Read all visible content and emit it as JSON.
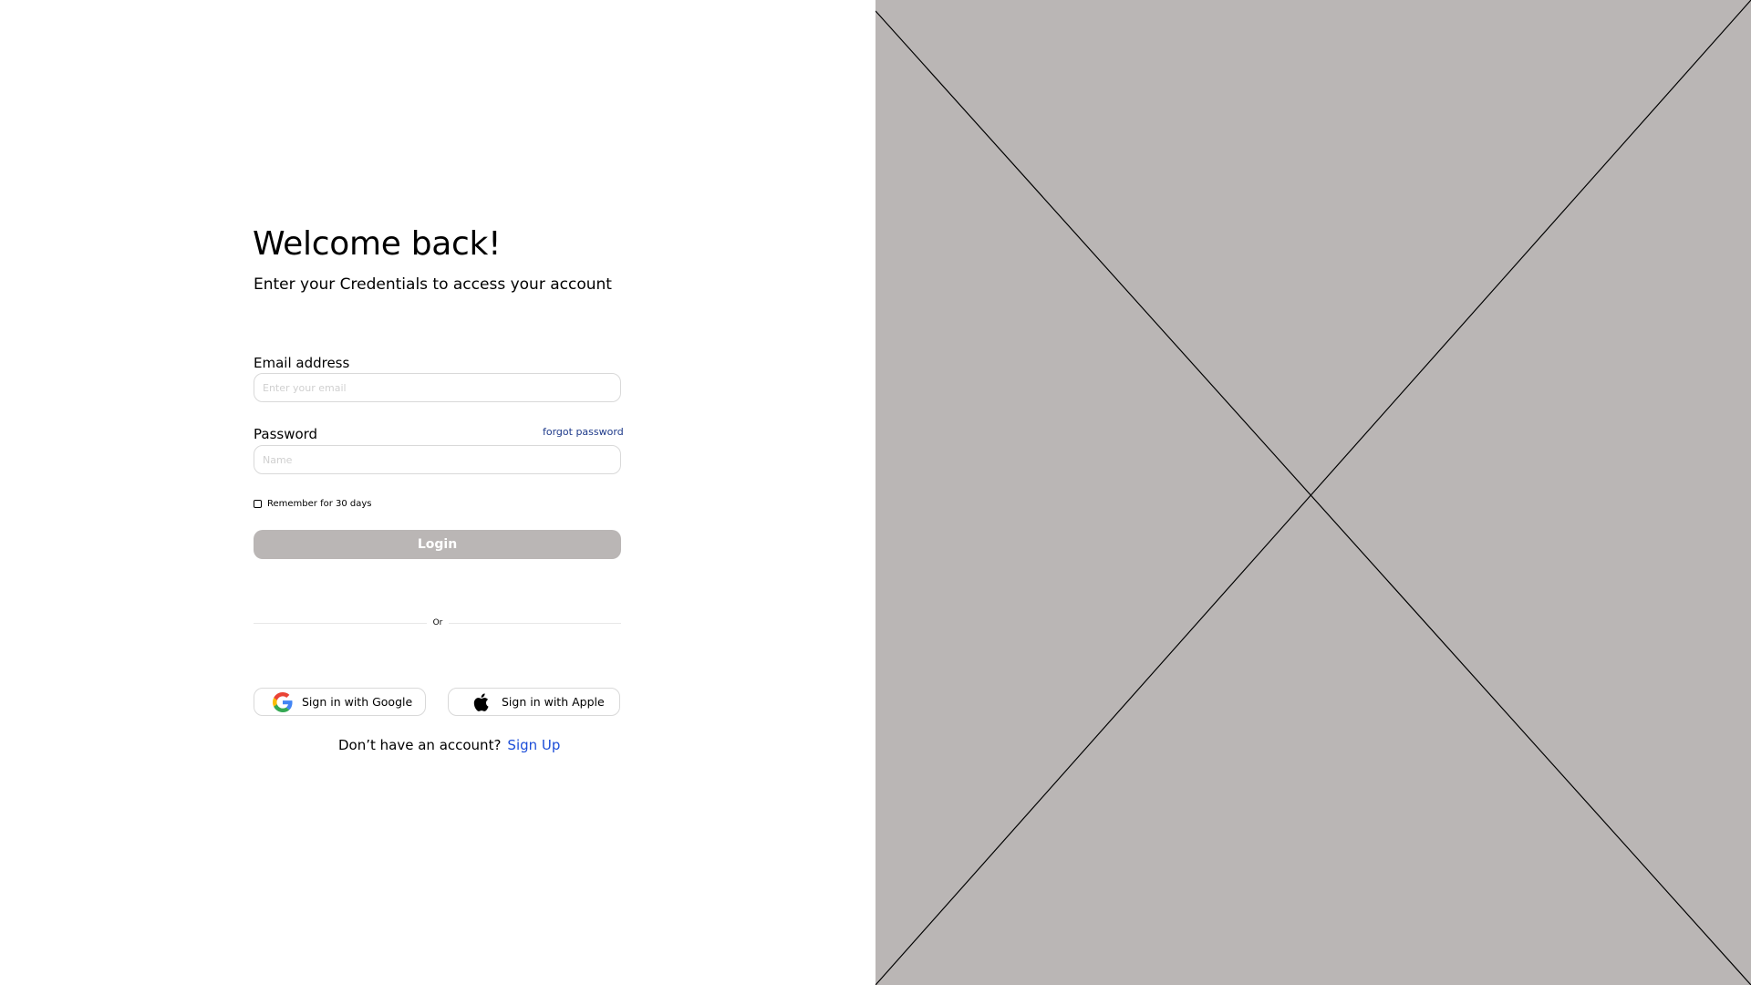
{
  "login": {
    "title": "Welcome back!",
    "subtitle": "Enter your Credentials to access your account",
    "email": {
      "label": "Email address",
      "placeholder": "Enter your email",
      "value": ""
    },
    "password": {
      "label": "Password",
      "placeholder": "Name",
      "value": "",
      "forgot_label": "forgot password"
    },
    "remember": {
      "label": "Remember for 30 days",
      "checked": false
    },
    "login_button": {
      "label": "Login"
    },
    "divider_label": "Or",
    "social": {
      "google_label": "Sign in with Google",
      "google_icon": "google-icon",
      "apple_label": "Sign in with Apple",
      "apple_icon": "apple-icon"
    },
    "signup": {
      "prompt": "Don’t have an account?",
      "link_label": "Sign Up"
    }
  },
  "image_placeholder": {
    "icon": "image-placeholder-x"
  },
  "colors": {
    "background": "#ffffff",
    "placeholder_panel": "#bab6b5",
    "login_button_bg": "#bab6b5",
    "login_button_text": "#ffffff",
    "forgot_link": "#1e3a8a",
    "signup_link": "#1d4ed8",
    "input_border": "#d9d9d9"
  }
}
